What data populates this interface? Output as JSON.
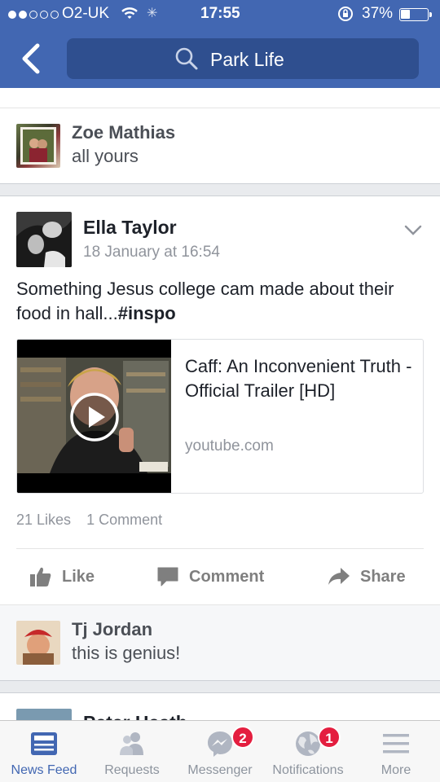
{
  "status_bar": {
    "carrier": "O2-UK",
    "time": "17:55",
    "battery_percent": "37%",
    "battery_level": 0.37
  },
  "header": {
    "search_text": "Park Life",
    "back_icon": "chevron-left-icon"
  },
  "comments_top": [
    {
      "name": "Zoe Mathias",
      "text": "all yours"
    }
  ],
  "post": {
    "author": "Ella Taylor",
    "timestamp": "18 January at 16:54",
    "text_plain": "Something Jesus college cam made about their food in hall...",
    "text_hashtag": "#inspo",
    "link": {
      "title": "Caff: An Inconvenient Truth - Official Trailer [HD]",
      "domain": "youtube.com"
    },
    "likes": "21 Likes",
    "comments": "1 Comment",
    "actions": {
      "like": "Like",
      "comment": "Comment",
      "share": "Share"
    }
  },
  "comments_bottom": [
    {
      "name": "Tj Jordan",
      "text": "this is genius!"
    },
    {
      "name": "Peter Heath"
    }
  ],
  "tabbar": {
    "tabs": [
      {
        "label": "News Feed",
        "icon": "news-feed-icon"
      },
      {
        "label": "Requests",
        "icon": "friend-requests-icon"
      },
      {
        "label": "Messenger",
        "icon": "messenger-icon",
        "badge": "2"
      },
      {
        "label": "Notifications",
        "icon": "globe-icon",
        "badge": "1"
      },
      {
        "label": "More",
        "icon": "menu-icon"
      }
    ]
  },
  "colors": {
    "brand": "#4267b2",
    "badge": "#e41e3f"
  }
}
